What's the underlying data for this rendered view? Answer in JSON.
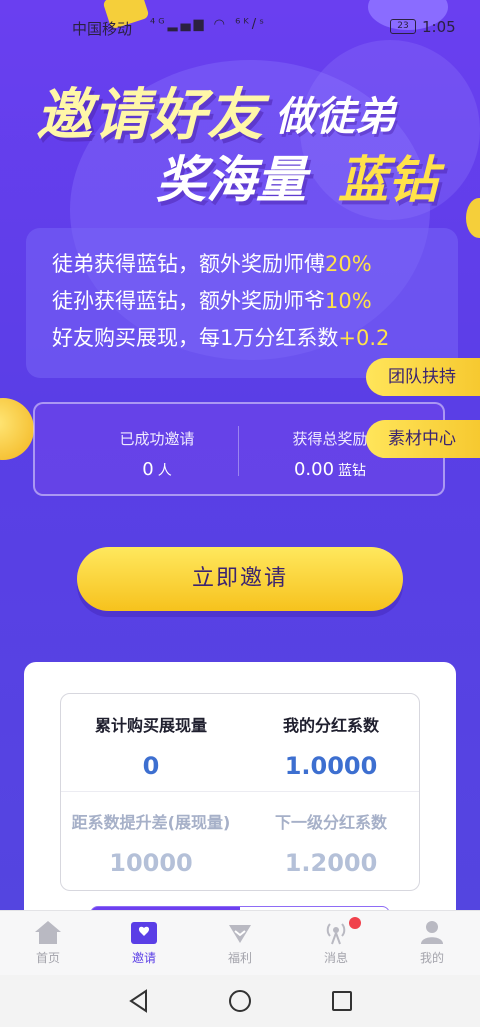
{
  "status_bar": {
    "carrier": "中国移动",
    "icons": "⁴ᴳ▂▄▆ ◠ ⁶ᴷ/ˢ",
    "battery": "23",
    "time": "1:05"
  },
  "header": {
    "line1_big": "邀请好友",
    "line1_small": "做徒弟",
    "line2_white": "奖海量",
    "line2_yellow": "蓝钻"
  },
  "info": [
    {
      "text": "徒弟获得蓝钻，额外奖励师傅",
      "highlight": "20%"
    },
    {
      "text": "徒孙获得蓝钻，额外奖励师爷",
      "highlight": "10%"
    },
    {
      "text": "好友购买展现，每1万分红系数",
      "highlight": "+0.2"
    }
  ],
  "side_tabs": {
    "team": "团队扶持",
    "material": "素材中心"
  },
  "stats": {
    "invited_label": "已成功邀请",
    "invited_value": "0",
    "invited_unit": "人",
    "reward_label": "获得总奖励",
    "reward_value": "0.00",
    "reward_unit": "蓝钻"
  },
  "invite_button": "立即邀请",
  "card": {
    "cumulative_label": "累计购买展现量",
    "cumulative_value": "0",
    "coefficient_label": "我的分红系数",
    "coefficient_value": "1.0000",
    "gap_label": "距系数提升差(展现量)",
    "gap_value": "10000",
    "next_label": "下一级分红系数",
    "next_value": "1.2000"
  },
  "tabbar": {
    "items": [
      {
        "label": "首页",
        "icon": "home-icon"
      },
      {
        "label": "邀请",
        "icon": "invite-icon"
      },
      {
        "label": "福利",
        "icon": "heart-icon"
      },
      {
        "label": "消息",
        "icon": "broadcast-icon"
      },
      {
        "label": "我的",
        "icon": "user-icon"
      }
    ],
    "active_index": 1
  },
  "colors": {
    "primary_purple": "#5a3ee6",
    "accent_yellow": "#ffe24a",
    "value_blue": "#3d6fd0",
    "badge_red": "#f0414c"
  }
}
